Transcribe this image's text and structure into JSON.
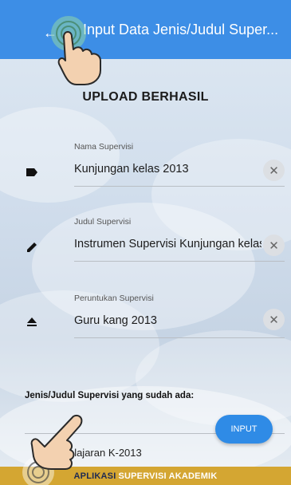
{
  "appbar": {
    "title": "Input Data Jenis/Judul Super...",
    "back_icon": "arrow-left-icon",
    "color": "#3d8ee6"
  },
  "status": {
    "message": "UPLOAD BERHASIL"
  },
  "fields": [
    {
      "label": "Nama Supervisi",
      "value": "Kunjungan kelas 2013",
      "icon": "label-tag-icon"
    },
    {
      "label": "Judul Supervisi",
      "value": "Instrumen Supervisi Kunjungan kelas",
      "icon": "pencil-icon"
    },
    {
      "label": "Peruntukan Supervisi",
      "value": "Guru kang 2013",
      "icon": "eject-icon"
    }
  ],
  "existing": {
    "heading": "Jenis/Judul Supervisi yang sudah ada:",
    "items": [
      "Pembelajaran K-2013"
    ]
  },
  "input_button": {
    "label": "INPUT",
    "color": "#2f8be6"
  },
  "footer": {
    "part1": "APLIKASI",
    "part2": "SUPERVISI AKADEMIK",
    "color": "#d4a632"
  }
}
